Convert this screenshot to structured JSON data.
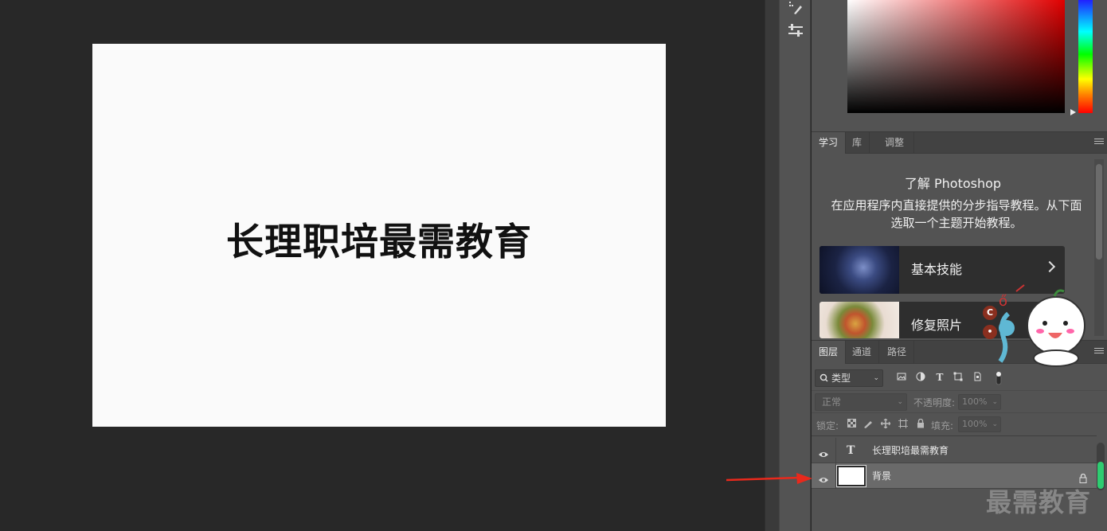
{
  "document": {
    "canvas_text": "长理职培最需教育"
  },
  "learn_panel": {
    "tabs": [
      "学习",
      "库",
      "调整"
    ],
    "title": "了解 Photoshop",
    "description": "在应用程序内直接提供的分步指导教程。从下面选取一个主题开始教程。",
    "cards": [
      {
        "label": "基本技能"
      },
      {
        "label": "修复照片"
      }
    ]
  },
  "layers_panel": {
    "tabs": [
      "图层",
      "通道",
      "路径"
    ],
    "filter_label": "类型",
    "blend_mode": "正常",
    "opacity_label": "不透明度:",
    "opacity_value": "100%",
    "lock_label": "锁定:",
    "fill_label": "填充:",
    "fill_value": "100%",
    "layers": [
      {
        "name": "长理职培最需教育",
        "kind": "text",
        "type_glyph": "T"
      },
      {
        "name": "背景",
        "kind": "background"
      }
    ]
  },
  "watermark": "最需教育",
  "colors": {
    "accent_arrow": "#e8291c",
    "scroll_green": "#2ecc71"
  }
}
